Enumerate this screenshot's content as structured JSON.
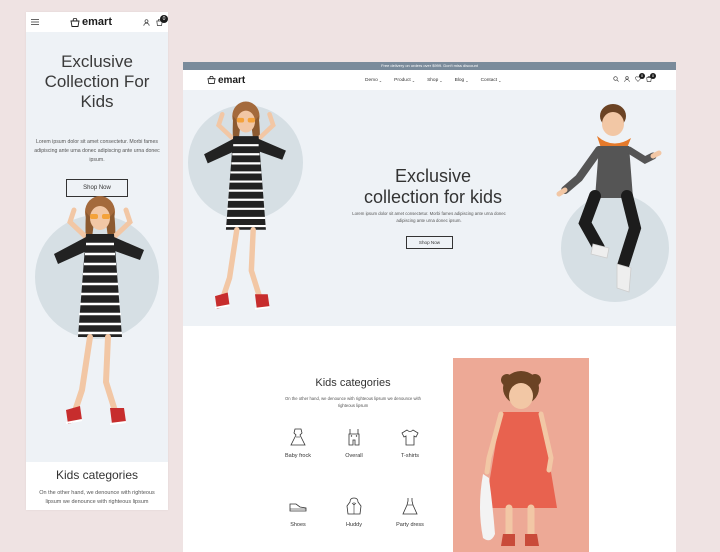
{
  "brand": {
    "name": "emart"
  },
  "cart": {
    "count": "0"
  },
  "mobile": {
    "hero": {
      "title_l1": "Exclusive",
      "title_l2": "Collection For",
      "title_l3": "Kids",
      "description": "Lorem ipsum dolor sit amet consectetur. Morbi fames adipiscing ante urna donec adipiscing ante urna donec ipsum.",
      "button": "Shop Now"
    },
    "categories": {
      "title": "Kids categories",
      "description": "On the other hand, we denounce with righteous lipsum we denounce with righteous lipsum"
    }
  },
  "desktop": {
    "announcement": "Free delivery on orders over $999. Don't miss discount",
    "menu": [
      "Demo",
      "Product",
      "Shop",
      "Blog",
      "Contact"
    ],
    "hero": {
      "title_l1": "Exclusive",
      "title_l2": "collection for kids",
      "description": "Lorem ipsum dolor sit amet consectetur. Morbi fames adipiscing ante urna donec adipiscing ante urna donec ipsum.",
      "button": "Shop Now"
    },
    "categories": {
      "title": "Kids categories",
      "description": "On the other hand, we denounce with righteous lipsum we denounce with righteous lipsum",
      "items": [
        {
          "label": "Baby frock",
          "icon": "frock-icon"
        },
        {
          "label": "Overall",
          "icon": "overall-icon"
        },
        {
          "label": "T-shirts",
          "icon": "tshirt-icon"
        },
        {
          "label": "Shoes",
          "icon": "shoe-icon"
        },
        {
          "label": "Huddy",
          "icon": "hoodie-icon"
        },
        {
          "label": "Party dress",
          "icon": "party-dress-icon"
        }
      ]
    }
  },
  "colors": {
    "hero_bg": "#eef2f6",
    "circle": "#d6dfe4",
    "announce_bg": "#7a8b9b",
    "promo_bg": "#eda996",
    "page_bg": "#efe3e3"
  }
}
